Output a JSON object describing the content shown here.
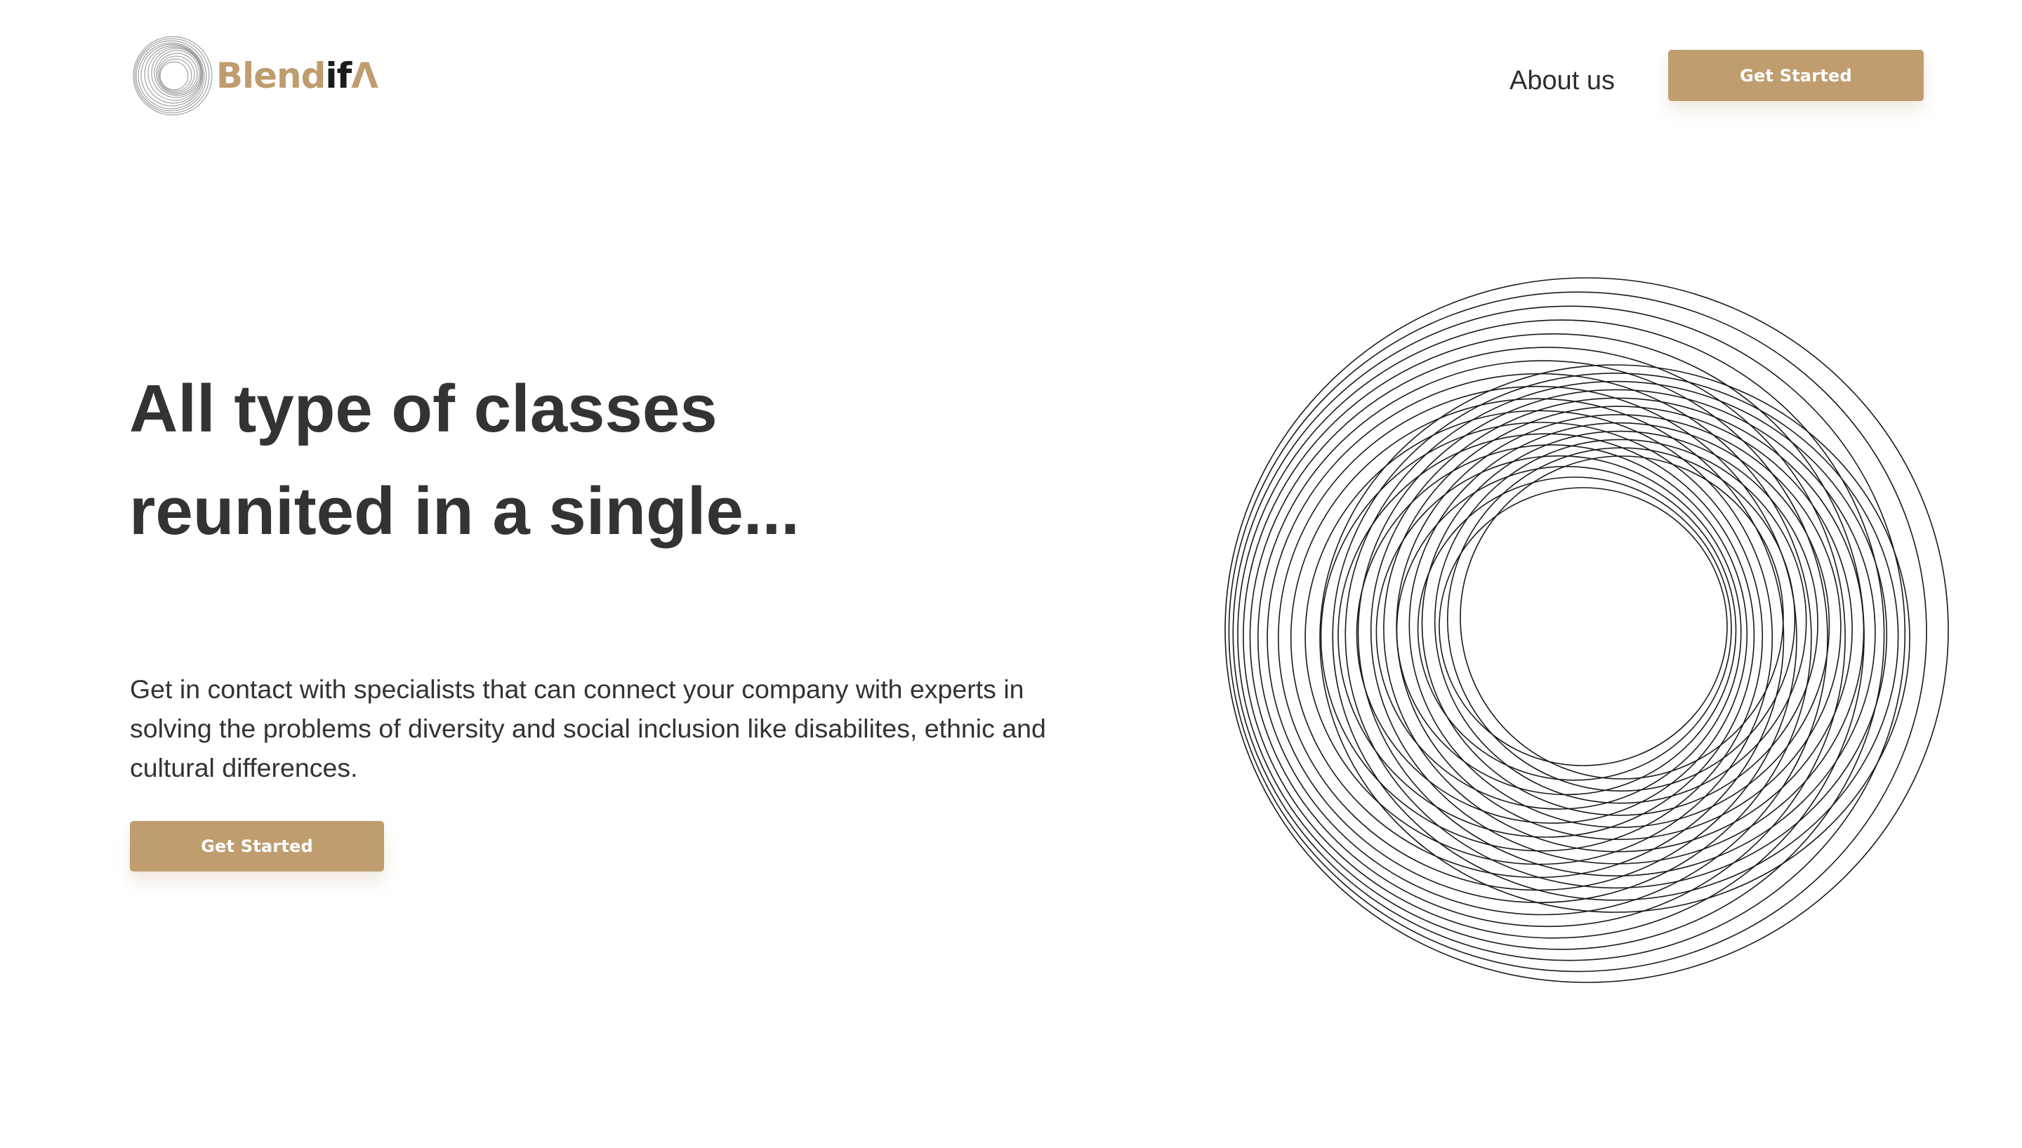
{
  "header": {
    "logo": {
      "brand_part1": "Blend",
      "brand_part2": "if",
      "brand_part3": "Λ",
      "icon": "swirl-logo-icon"
    },
    "nav": {
      "about_label": "About us"
    },
    "cta_label": "Get Started"
  },
  "hero": {
    "title_line1": "All type of classes",
    "title_line2": "reunited in a single...",
    "description": "Get in contact with specialists that can connect your company with experts in solving the problems of diversity and social inclusion like disabilites, ethnic and cultural differences.",
    "cta_label": "Get Started",
    "illustration": "concentric-ring-illustration"
  },
  "colors": {
    "accent": "#bf9d6f",
    "text": "#333333",
    "background": "#ffffff"
  }
}
